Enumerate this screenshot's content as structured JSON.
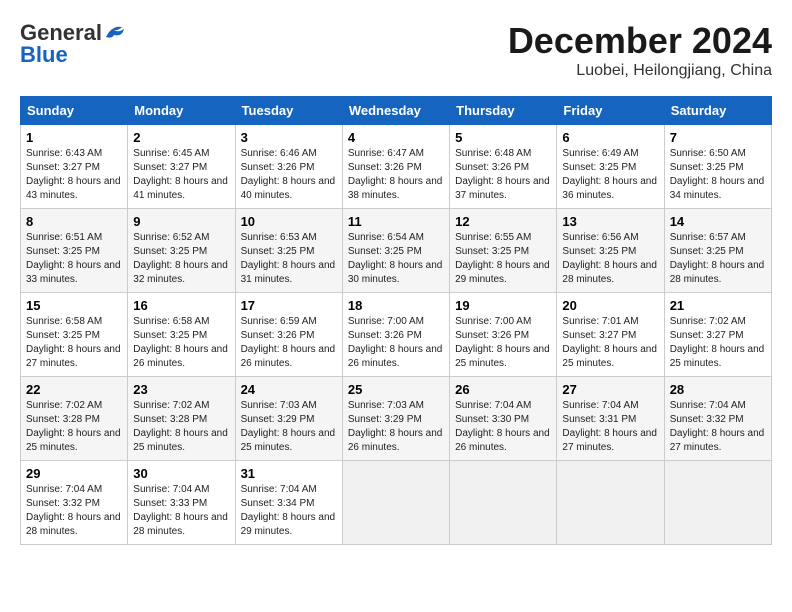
{
  "header": {
    "logo_general": "General",
    "logo_blue": "Blue",
    "month_title": "December 2024",
    "location": "Luobei, Heilongjiang, China"
  },
  "weekdays": [
    "Sunday",
    "Monday",
    "Tuesday",
    "Wednesday",
    "Thursday",
    "Friday",
    "Saturday"
  ],
  "weeks": [
    [
      {
        "day": "1",
        "sunrise": "6:43 AM",
        "sunset": "3:27 PM",
        "daylight": "8 hours and 43 minutes."
      },
      {
        "day": "2",
        "sunrise": "6:45 AM",
        "sunset": "3:27 PM",
        "daylight": "8 hours and 41 minutes."
      },
      {
        "day": "3",
        "sunrise": "6:46 AM",
        "sunset": "3:26 PM",
        "daylight": "8 hours and 40 minutes."
      },
      {
        "day": "4",
        "sunrise": "6:47 AM",
        "sunset": "3:26 PM",
        "daylight": "8 hours and 38 minutes."
      },
      {
        "day": "5",
        "sunrise": "6:48 AM",
        "sunset": "3:26 PM",
        "daylight": "8 hours and 37 minutes."
      },
      {
        "day": "6",
        "sunrise": "6:49 AM",
        "sunset": "3:25 PM",
        "daylight": "8 hours and 36 minutes."
      },
      {
        "day": "7",
        "sunrise": "6:50 AM",
        "sunset": "3:25 PM",
        "daylight": "8 hours and 34 minutes."
      }
    ],
    [
      {
        "day": "8",
        "sunrise": "6:51 AM",
        "sunset": "3:25 PM",
        "daylight": "8 hours and 33 minutes."
      },
      {
        "day": "9",
        "sunrise": "6:52 AM",
        "sunset": "3:25 PM",
        "daylight": "8 hours and 32 minutes."
      },
      {
        "day": "10",
        "sunrise": "6:53 AM",
        "sunset": "3:25 PM",
        "daylight": "8 hours and 31 minutes."
      },
      {
        "day": "11",
        "sunrise": "6:54 AM",
        "sunset": "3:25 PM",
        "daylight": "8 hours and 30 minutes."
      },
      {
        "day": "12",
        "sunrise": "6:55 AM",
        "sunset": "3:25 PM",
        "daylight": "8 hours and 29 minutes."
      },
      {
        "day": "13",
        "sunrise": "6:56 AM",
        "sunset": "3:25 PM",
        "daylight": "8 hours and 28 minutes."
      },
      {
        "day": "14",
        "sunrise": "6:57 AM",
        "sunset": "3:25 PM",
        "daylight": "8 hours and 28 minutes."
      }
    ],
    [
      {
        "day": "15",
        "sunrise": "6:58 AM",
        "sunset": "3:25 PM",
        "daylight": "8 hours and 27 minutes."
      },
      {
        "day": "16",
        "sunrise": "6:58 AM",
        "sunset": "3:25 PM",
        "daylight": "8 hours and 26 minutes."
      },
      {
        "day": "17",
        "sunrise": "6:59 AM",
        "sunset": "3:26 PM",
        "daylight": "8 hours and 26 minutes."
      },
      {
        "day": "18",
        "sunrise": "7:00 AM",
        "sunset": "3:26 PM",
        "daylight": "8 hours and 26 minutes."
      },
      {
        "day": "19",
        "sunrise": "7:00 AM",
        "sunset": "3:26 PM",
        "daylight": "8 hours and 25 minutes."
      },
      {
        "day": "20",
        "sunrise": "7:01 AM",
        "sunset": "3:27 PM",
        "daylight": "8 hours and 25 minutes."
      },
      {
        "day": "21",
        "sunrise": "7:02 AM",
        "sunset": "3:27 PM",
        "daylight": "8 hours and 25 minutes."
      }
    ],
    [
      {
        "day": "22",
        "sunrise": "7:02 AM",
        "sunset": "3:28 PM",
        "daylight": "8 hours and 25 minutes."
      },
      {
        "day": "23",
        "sunrise": "7:02 AM",
        "sunset": "3:28 PM",
        "daylight": "8 hours and 25 minutes."
      },
      {
        "day": "24",
        "sunrise": "7:03 AM",
        "sunset": "3:29 PM",
        "daylight": "8 hours and 25 minutes."
      },
      {
        "day": "25",
        "sunrise": "7:03 AM",
        "sunset": "3:29 PM",
        "daylight": "8 hours and 26 minutes."
      },
      {
        "day": "26",
        "sunrise": "7:04 AM",
        "sunset": "3:30 PM",
        "daylight": "8 hours and 26 minutes."
      },
      {
        "day": "27",
        "sunrise": "7:04 AM",
        "sunset": "3:31 PM",
        "daylight": "8 hours and 27 minutes."
      },
      {
        "day": "28",
        "sunrise": "7:04 AM",
        "sunset": "3:32 PM",
        "daylight": "8 hours and 27 minutes."
      }
    ],
    [
      {
        "day": "29",
        "sunrise": "7:04 AM",
        "sunset": "3:32 PM",
        "daylight": "8 hours and 28 minutes."
      },
      {
        "day": "30",
        "sunrise": "7:04 AM",
        "sunset": "3:33 PM",
        "daylight": "8 hours and 28 minutes."
      },
      {
        "day": "31",
        "sunrise": "7:04 AM",
        "sunset": "3:34 PM",
        "daylight": "8 hours and 29 minutes."
      },
      null,
      null,
      null,
      null
    ]
  ]
}
